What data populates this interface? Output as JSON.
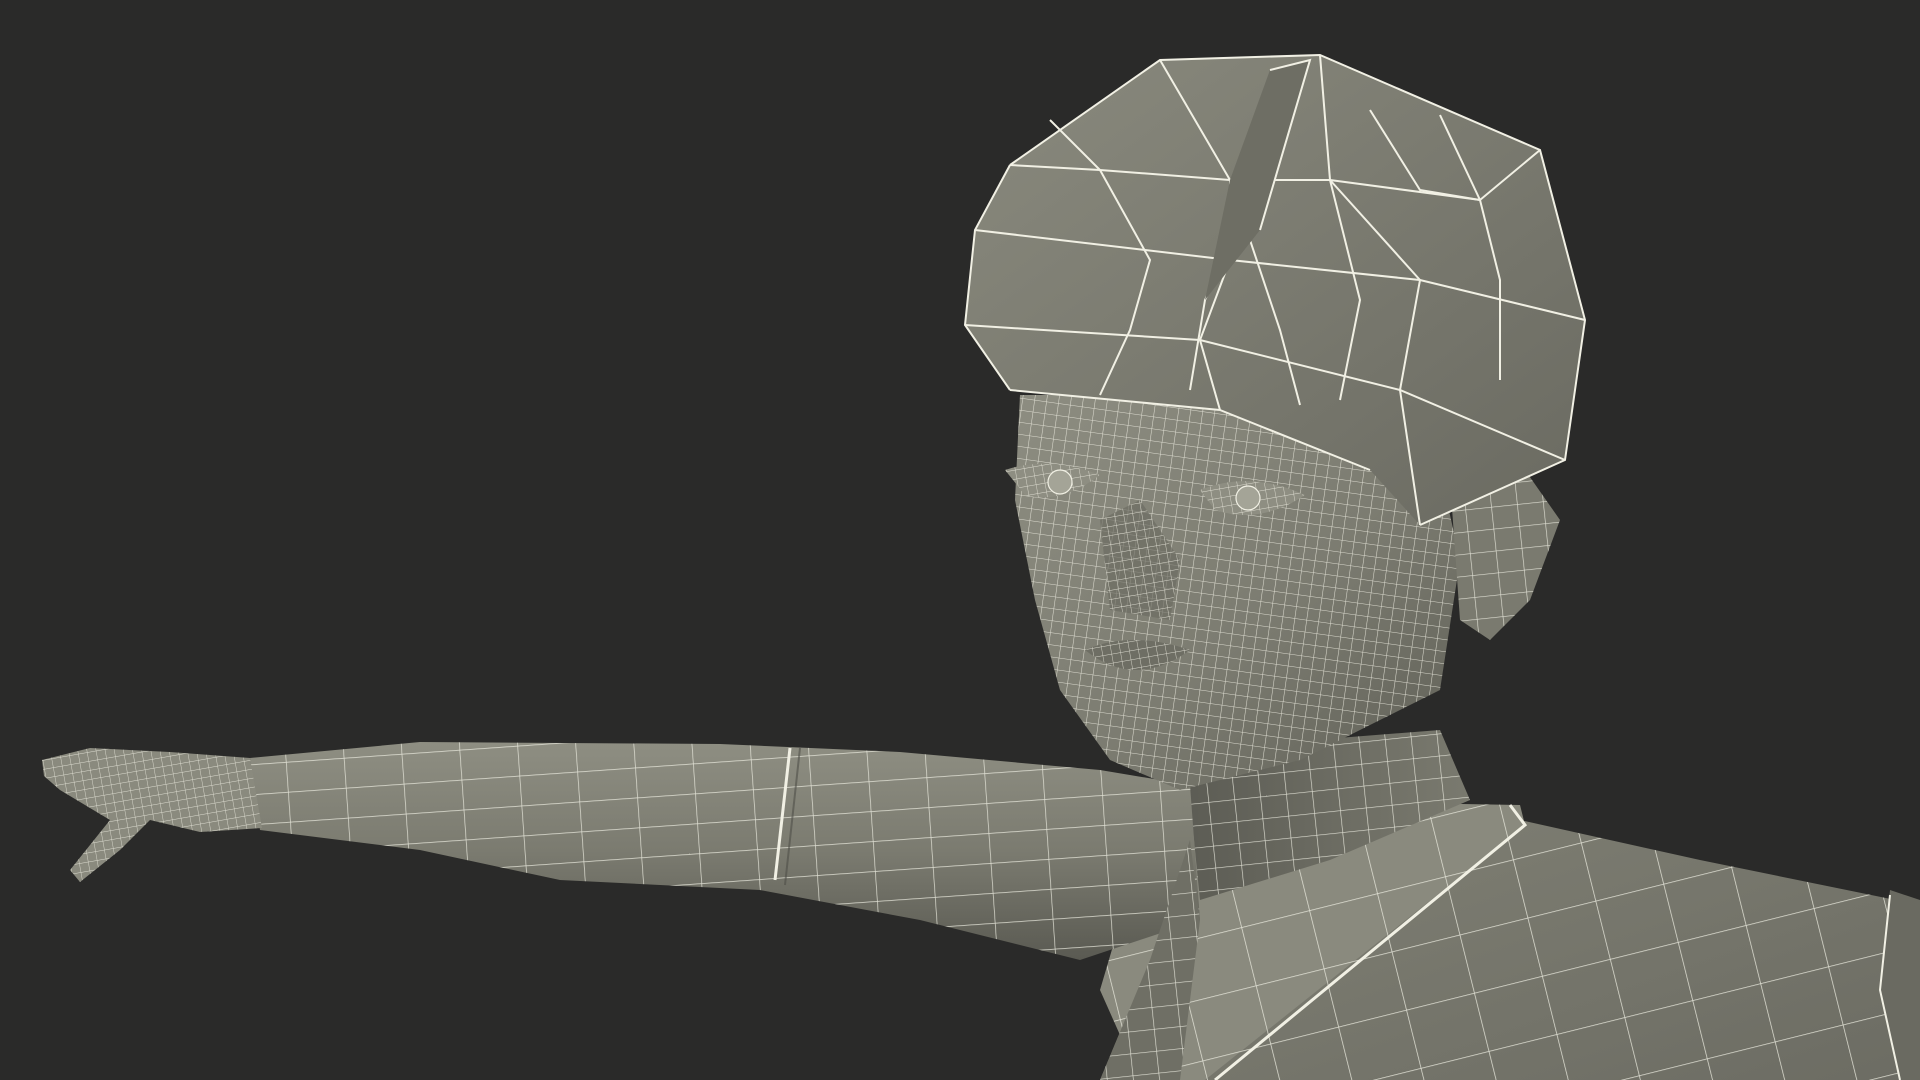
{
  "scene": {
    "subject": "wireframe-child-model",
    "colors": {
      "background": "#2a2a29",
      "surface_light": "#9a9a8d",
      "surface_mid": "#7f7f73",
      "surface_dark": "#5e5e55",
      "wire": "#f1f0e4"
    }
  }
}
